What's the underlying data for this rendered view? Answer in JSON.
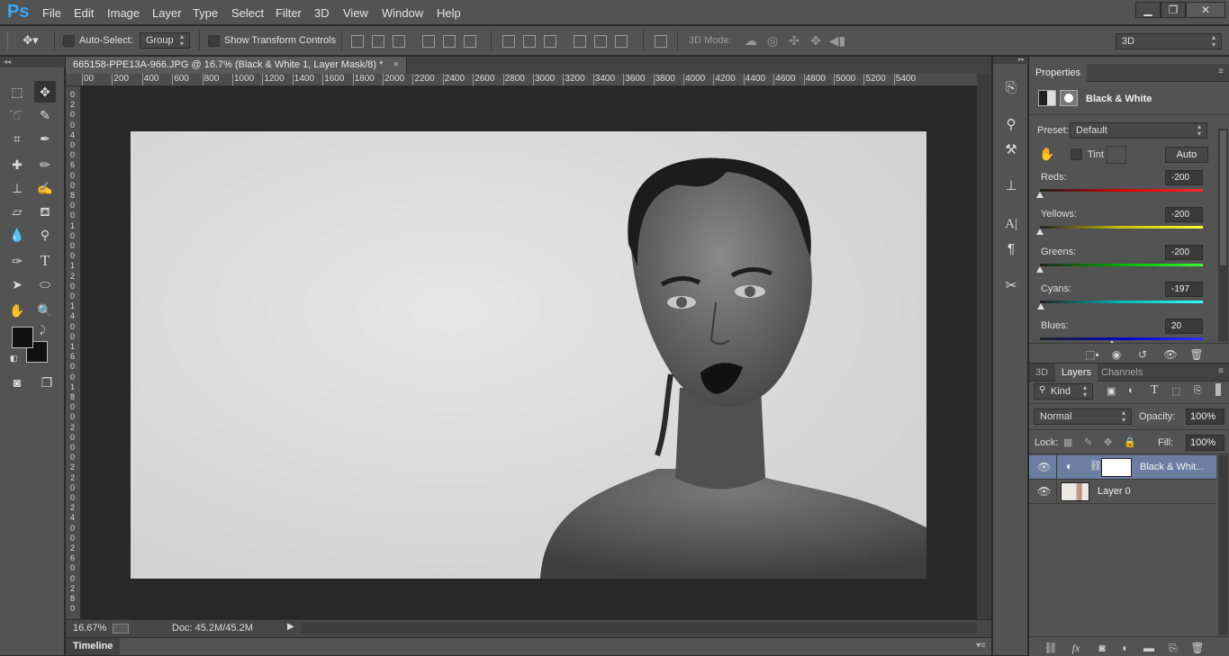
{
  "app": {
    "logo": "Ps"
  },
  "menu": [
    "File",
    "Edit",
    "Image",
    "Layer",
    "Type",
    "Select",
    "Filter",
    "3D",
    "View",
    "Window",
    "Help"
  ],
  "window_controls": {
    "minimize": "▁",
    "restore": "❐",
    "close": "✕"
  },
  "options": {
    "auto_select_label": "Auto-Select:",
    "auto_select_value": "Group",
    "show_transform_label": "Show Transform Controls",
    "mode3d_label": "3D Mode:",
    "workspace_value": "3D"
  },
  "document": {
    "tab_title": "665158-PPE13A-966.JPG @ 16.7% (Black & White 1, Layer Mask/8) *",
    "tab_close": "×",
    "zoom": "16.67%",
    "doc_size": "Doc: 45.2M/45.2M"
  },
  "ruler_top": [
    "00",
    "200",
    "400",
    "600",
    "800",
    "1000",
    "1200",
    "1400",
    "1600",
    "1800",
    "2000",
    "2200",
    "2400",
    "2600",
    "2800",
    "3000",
    "3200",
    "3400",
    "3600",
    "3800",
    "4000",
    "4200",
    "4400",
    "4600",
    "4800",
    "5000",
    "5200",
    "5400"
  ],
  "ruler_left": [
    "0",
    "2",
    "0",
    "0",
    "4",
    "0",
    "0",
    "6",
    "0",
    "0",
    "8",
    "0",
    "0",
    "1",
    "0",
    "0",
    "0",
    "1",
    "2",
    "0",
    "0",
    "1",
    "4",
    "0",
    "0",
    "1",
    "6",
    "0",
    "0",
    "1",
    "8",
    "0",
    "0",
    "2",
    "0",
    "0",
    "0",
    "2",
    "2",
    "0",
    "0",
    "2",
    "4",
    "0",
    "0",
    "2",
    "6",
    "0",
    "0",
    "2",
    "8",
    "0"
  ],
  "timeline": {
    "label": "Timeline"
  },
  "properties": {
    "tab": "Properties",
    "adjustment_title": "Black & White",
    "preset_label": "Preset:",
    "preset_value": "Default",
    "tint_label": "Tint",
    "auto_label": "Auto",
    "sliders": [
      {
        "label": "Reds:",
        "value": "-200",
        "level": 0
      },
      {
        "label": "Yellows:",
        "value": "-200",
        "level": 0
      },
      {
        "label": "Greens:",
        "value": "-200",
        "level": 0
      },
      {
        "label": "Cyans:",
        "value": "-197",
        "level": 0.005
      },
      {
        "label": "Blues:",
        "value": "20",
        "level": 0.44
      }
    ]
  },
  "layers_panel": {
    "tabs": [
      "3D",
      "Layers",
      "Channels"
    ],
    "active_tab": "Layers",
    "kind_label": "Kind",
    "blend_mode": "Normal",
    "opacity_label": "Opacity:",
    "opacity_value": "100%",
    "lock_label": "Lock:",
    "fill_label": "Fill:",
    "fill_value": "100%",
    "layers": [
      {
        "name": "Black & Whit...",
        "selected": true
      },
      {
        "name": "Layer 0",
        "selected": false
      }
    ]
  }
}
